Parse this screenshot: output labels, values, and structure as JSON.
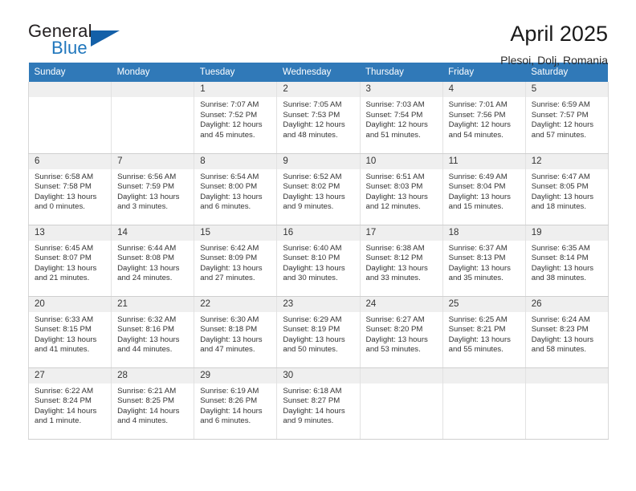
{
  "logo": {
    "word_general": "General",
    "word_blue": "Blue",
    "triangle_color": "#1460a8"
  },
  "header": {
    "title": "April 2025",
    "subtitle": "Plesoi, Dolj, Romania"
  },
  "colors": {
    "header_blue": "#3079b8",
    "day_band": "#efefef",
    "text": "#333333"
  },
  "calendar": {
    "weekday_headers": [
      "Sunday",
      "Monday",
      "Tuesday",
      "Wednesday",
      "Thursday",
      "Friday",
      "Saturday"
    ],
    "weeks": [
      [
        {
          "day": "",
          "lines": []
        },
        {
          "day": "",
          "lines": []
        },
        {
          "day": "1",
          "lines": [
            "Sunrise: 7:07 AM",
            "Sunset: 7:52 PM",
            "Daylight: 12 hours",
            "and 45 minutes."
          ]
        },
        {
          "day": "2",
          "lines": [
            "Sunrise: 7:05 AM",
            "Sunset: 7:53 PM",
            "Daylight: 12 hours",
            "and 48 minutes."
          ]
        },
        {
          "day": "3",
          "lines": [
            "Sunrise: 7:03 AM",
            "Sunset: 7:54 PM",
            "Daylight: 12 hours",
            "and 51 minutes."
          ]
        },
        {
          "day": "4",
          "lines": [
            "Sunrise: 7:01 AM",
            "Sunset: 7:56 PM",
            "Daylight: 12 hours",
            "and 54 minutes."
          ]
        },
        {
          "day": "5",
          "lines": [
            "Sunrise: 6:59 AM",
            "Sunset: 7:57 PM",
            "Daylight: 12 hours",
            "and 57 minutes."
          ]
        }
      ],
      [
        {
          "day": "6",
          "lines": [
            "Sunrise: 6:58 AM",
            "Sunset: 7:58 PM",
            "Daylight: 13 hours",
            "and 0 minutes."
          ]
        },
        {
          "day": "7",
          "lines": [
            "Sunrise: 6:56 AM",
            "Sunset: 7:59 PM",
            "Daylight: 13 hours",
            "and 3 minutes."
          ]
        },
        {
          "day": "8",
          "lines": [
            "Sunrise: 6:54 AM",
            "Sunset: 8:00 PM",
            "Daylight: 13 hours",
            "and 6 minutes."
          ]
        },
        {
          "day": "9",
          "lines": [
            "Sunrise: 6:52 AM",
            "Sunset: 8:02 PM",
            "Daylight: 13 hours",
            "and 9 minutes."
          ]
        },
        {
          "day": "10",
          "lines": [
            "Sunrise: 6:51 AM",
            "Sunset: 8:03 PM",
            "Daylight: 13 hours",
            "and 12 minutes."
          ]
        },
        {
          "day": "11",
          "lines": [
            "Sunrise: 6:49 AM",
            "Sunset: 8:04 PM",
            "Daylight: 13 hours",
            "and 15 minutes."
          ]
        },
        {
          "day": "12",
          "lines": [
            "Sunrise: 6:47 AM",
            "Sunset: 8:05 PM",
            "Daylight: 13 hours",
            "and 18 minutes."
          ]
        }
      ],
      [
        {
          "day": "13",
          "lines": [
            "Sunrise: 6:45 AM",
            "Sunset: 8:07 PM",
            "Daylight: 13 hours",
            "and 21 minutes."
          ]
        },
        {
          "day": "14",
          "lines": [
            "Sunrise: 6:44 AM",
            "Sunset: 8:08 PM",
            "Daylight: 13 hours",
            "and 24 minutes."
          ]
        },
        {
          "day": "15",
          "lines": [
            "Sunrise: 6:42 AM",
            "Sunset: 8:09 PM",
            "Daylight: 13 hours",
            "and 27 minutes."
          ]
        },
        {
          "day": "16",
          "lines": [
            "Sunrise: 6:40 AM",
            "Sunset: 8:10 PM",
            "Daylight: 13 hours",
            "and 30 minutes."
          ]
        },
        {
          "day": "17",
          "lines": [
            "Sunrise: 6:38 AM",
            "Sunset: 8:12 PM",
            "Daylight: 13 hours",
            "and 33 minutes."
          ]
        },
        {
          "day": "18",
          "lines": [
            "Sunrise: 6:37 AM",
            "Sunset: 8:13 PM",
            "Daylight: 13 hours",
            "and 35 minutes."
          ]
        },
        {
          "day": "19",
          "lines": [
            "Sunrise: 6:35 AM",
            "Sunset: 8:14 PM",
            "Daylight: 13 hours",
            "and 38 minutes."
          ]
        }
      ],
      [
        {
          "day": "20",
          "lines": [
            "Sunrise: 6:33 AM",
            "Sunset: 8:15 PM",
            "Daylight: 13 hours",
            "and 41 minutes."
          ]
        },
        {
          "day": "21",
          "lines": [
            "Sunrise: 6:32 AM",
            "Sunset: 8:16 PM",
            "Daylight: 13 hours",
            "and 44 minutes."
          ]
        },
        {
          "day": "22",
          "lines": [
            "Sunrise: 6:30 AM",
            "Sunset: 8:18 PM",
            "Daylight: 13 hours",
            "and 47 minutes."
          ]
        },
        {
          "day": "23",
          "lines": [
            "Sunrise: 6:29 AM",
            "Sunset: 8:19 PM",
            "Daylight: 13 hours",
            "and 50 minutes."
          ]
        },
        {
          "day": "24",
          "lines": [
            "Sunrise: 6:27 AM",
            "Sunset: 8:20 PM",
            "Daylight: 13 hours",
            "and 53 minutes."
          ]
        },
        {
          "day": "25",
          "lines": [
            "Sunrise: 6:25 AM",
            "Sunset: 8:21 PM",
            "Daylight: 13 hours",
            "and 55 minutes."
          ]
        },
        {
          "day": "26",
          "lines": [
            "Sunrise: 6:24 AM",
            "Sunset: 8:23 PM",
            "Daylight: 13 hours",
            "and 58 minutes."
          ]
        }
      ],
      [
        {
          "day": "27",
          "lines": [
            "Sunrise: 6:22 AM",
            "Sunset: 8:24 PM",
            "Daylight: 14 hours",
            "and 1 minute."
          ]
        },
        {
          "day": "28",
          "lines": [
            "Sunrise: 6:21 AM",
            "Sunset: 8:25 PM",
            "Daylight: 14 hours",
            "and 4 minutes."
          ]
        },
        {
          "day": "29",
          "lines": [
            "Sunrise: 6:19 AM",
            "Sunset: 8:26 PM",
            "Daylight: 14 hours",
            "and 6 minutes."
          ]
        },
        {
          "day": "30",
          "lines": [
            "Sunrise: 6:18 AM",
            "Sunset: 8:27 PM",
            "Daylight: 14 hours",
            "and 9 minutes."
          ]
        },
        {
          "day": "",
          "lines": []
        },
        {
          "day": "",
          "lines": []
        },
        {
          "day": "",
          "lines": []
        }
      ]
    ]
  }
}
